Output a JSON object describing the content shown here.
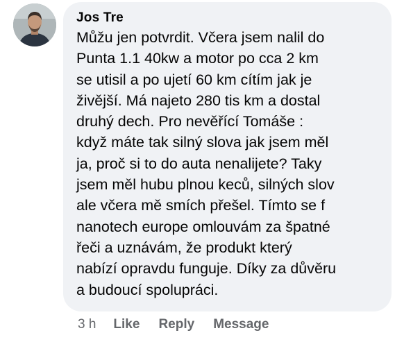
{
  "comment": {
    "author": "Jos Tre",
    "text": "Můžu jen potvrdit. Včera jsem nalil do\nPunta 1.1 40kw a motor po cca 2 km\nse utisil a po ujetí 60 km cítím jak je\nživější. Má najeto 280 tis km a dostal\ndruhý dech. Pro nevěřící Tomáše :\nkdyž máte tak silný slova jak jsem měl\nja, proč si to do auta nenalijete? Taky\njsem měl hubu plnou keců, silných slov\nale včera mě smích přešel. Tímto se f\nnanotech europe omlouvám za špatné\nřeči a uznávám, že produkt který\nnabízí opravdu funguje. Díky za důvěru\na budoucí spolupráci.",
    "time": "3 h",
    "actions": {
      "like": "Like",
      "reply": "Reply",
      "message": "Message"
    }
  },
  "colors": {
    "bubble_bg": "#f0f2f5",
    "text": "#050505",
    "secondary_text": "#65676b"
  }
}
